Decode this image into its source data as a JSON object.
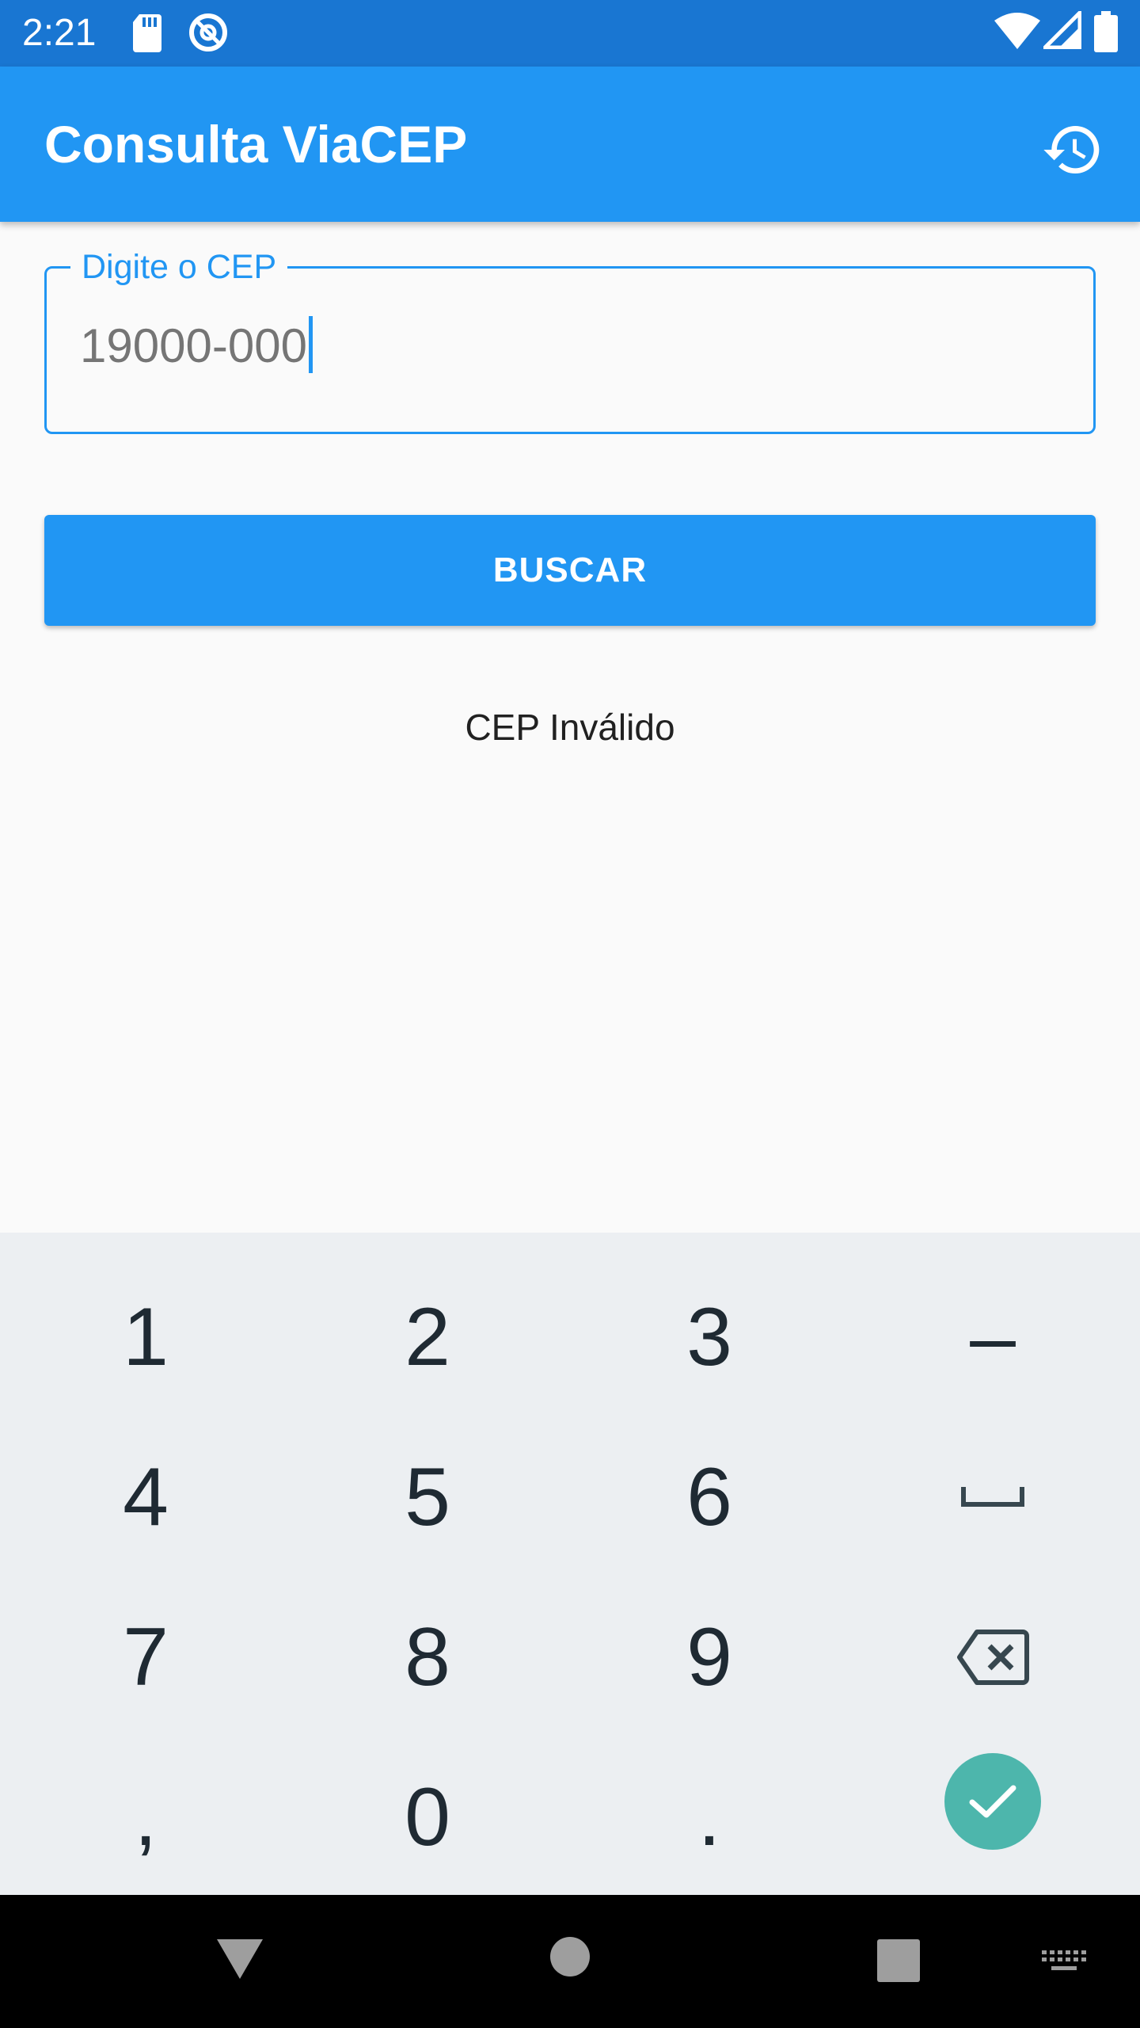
{
  "status_bar": {
    "time": "2:21",
    "icons": [
      "sd-card-icon",
      "sync-icon",
      "wifi-icon",
      "signal-icon",
      "battery-icon"
    ]
  },
  "app_bar": {
    "title": "Consulta ViaCEP",
    "action_icon": "history-icon"
  },
  "cep_field": {
    "label": "Digite o CEP",
    "value": "19000-000"
  },
  "search_button": {
    "label": "BUSCAR"
  },
  "result": {
    "message": "CEP Inválido"
  },
  "keyboard": {
    "keys": [
      [
        "1",
        "2",
        "3",
        "–"
      ],
      [
        "4",
        "5",
        "6",
        "space"
      ],
      [
        "7",
        "8",
        "9",
        "backspace"
      ],
      [
        ",",
        "0",
        ".",
        "done"
      ]
    ]
  },
  "nav_bar": {
    "buttons": [
      "back-icon",
      "home-icon",
      "recents-icon",
      "keyboard-icon"
    ]
  },
  "colors": {
    "primary": "#2196f3",
    "status_bar": "#1976d2",
    "keyboard_bg": "#eceff2",
    "done_key": "#4db6ac"
  }
}
